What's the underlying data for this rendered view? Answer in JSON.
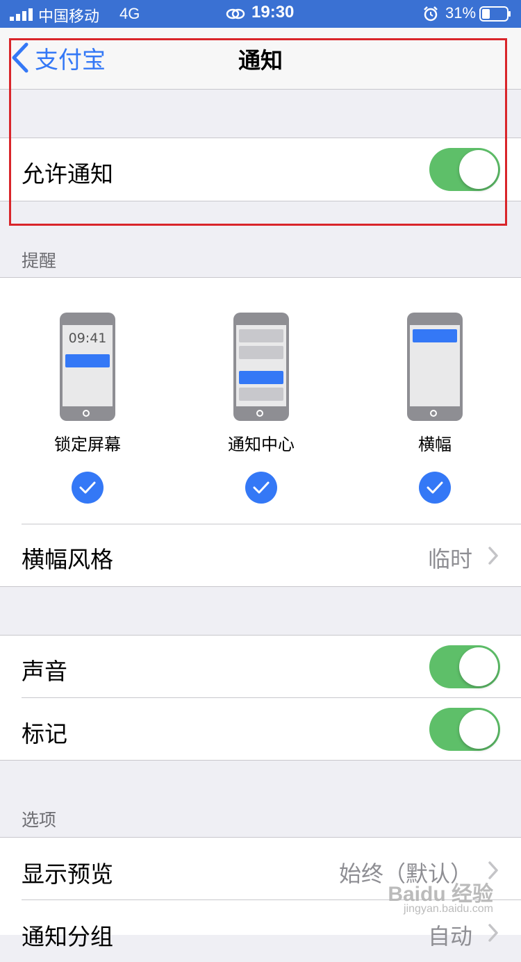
{
  "status_bar": {
    "carrier": "中国移动",
    "network": "4G",
    "time": "19:30",
    "battery_percent": "31%",
    "icons": [
      "signal-icon",
      "link-icon",
      "alarm-icon",
      "battery-icon"
    ]
  },
  "nav": {
    "back_label": "支付宝",
    "title": "通知"
  },
  "allow_notifications": {
    "label": "允许通知",
    "enabled": true
  },
  "alerts": {
    "header": "提醒",
    "styles": [
      {
        "label": "锁定屏幕",
        "checked": true,
        "preview_time": "09:41"
      },
      {
        "label": "通知中心",
        "checked": true
      },
      {
        "label": "横幅",
        "checked": true
      }
    ],
    "banner_style": {
      "label": "横幅风格",
      "value": "临时"
    }
  },
  "sounds": {
    "label": "声音",
    "enabled": true
  },
  "badges": {
    "label": "标记",
    "enabled": true
  },
  "options": {
    "header": "选项",
    "show_previews": {
      "label": "显示预览",
      "value": "始终（默认）"
    },
    "grouping": {
      "label": "通知分组",
      "value": "自动"
    }
  },
  "watermark": {
    "text": "Baidu 经验",
    "url": "jingyan.baidu.com"
  },
  "colors": {
    "accent": "#3478f6",
    "toggle_on": "#5ebf69",
    "status_bar": "#3a71d3",
    "highlight": "#d9252a"
  }
}
